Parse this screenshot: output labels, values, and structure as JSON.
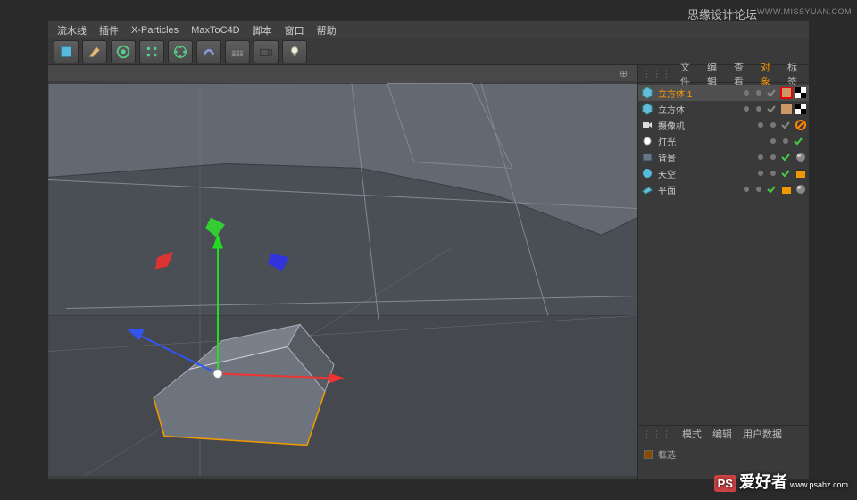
{
  "menubar": {
    "items": [
      "流水线",
      "插件",
      "X-Particles",
      "MaxToC4D",
      "脚本",
      "窗口",
      "帮助"
    ]
  },
  "toolbar": {
    "tools": [
      "cube",
      "pen",
      "subdiv",
      "array",
      "clone",
      "bend",
      "floor",
      "camera",
      "light"
    ]
  },
  "viewport": {
    "controls": "⊕ ⇔ ↻ ▢"
  },
  "object_manager": {
    "menu": {
      "file": "文件",
      "edit": "编辑",
      "view": "查看",
      "object": "对象",
      "tags": "标签"
    },
    "objects": [
      {
        "name": "立方体.1",
        "icon": "primitive",
        "selected": true,
        "tags": [
          "texture-highlight",
          "checker"
        ],
        "vis": [
          "dot",
          "dot"
        ],
        "check": "gray"
      },
      {
        "name": "立方体",
        "icon": "primitive",
        "tags": [
          "texture",
          "checker"
        ],
        "vis": [
          "dot",
          "dot"
        ],
        "check": "gray"
      },
      {
        "name": "摄像机",
        "icon": "camera",
        "tags": [
          "no-render"
        ],
        "vis": [
          "dot",
          "dot"
        ],
        "check": "gray"
      },
      {
        "name": "灯光",
        "icon": "light",
        "tags": [],
        "vis": [
          "dot",
          "dot"
        ],
        "check": "green"
      },
      {
        "name": "背景",
        "icon": "bg",
        "tags": [
          "material"
        ],
        "vis": [
          "dot",
          "dot"
        ],
        "check": "green"
      },
      {
        "name": "天空",
        "icon": "sky",
        "tags": [
          "clapper"
        ],
        "vis": [
          "dot",
          "dot"
        ],
        "check": "green"
      },
      {
        "name": "平面",
        "icon": "plane",
        "tags": [
          "clapper",
          "material"
        ],
        "vis": [
          "dot",
          "dot"
        ],
        "check": "green"
      }
    ]
  },
  "attribute_manager": {
    "menu": {
      "mode": "模式",
      "edit": "编辑",
      "userdata": "用户数据"
    },
    "label": "框选"
  },
  "watermarks": {
    "tl": "思缘设计论坛",
    "tr": "WWW.MISSYUAN.COM",
    "br_ps": "PS",
    "br_main": "爱好者",
    "br_sub": "www.psahz.com"
  }
}
